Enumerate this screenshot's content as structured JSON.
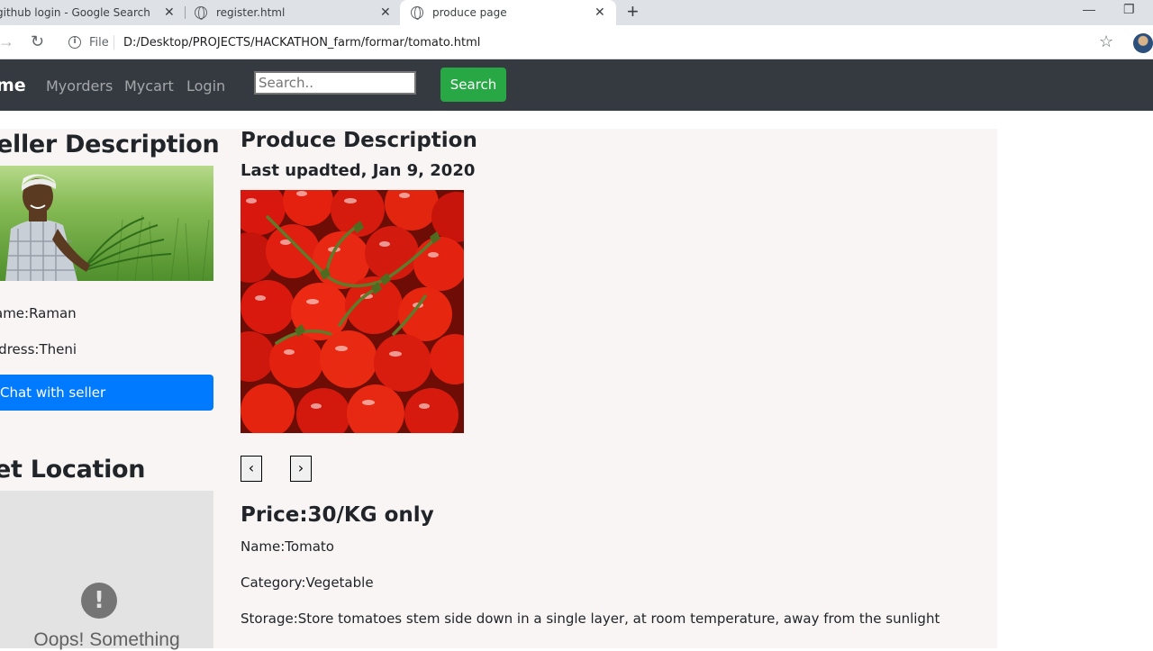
{
  "browser": {
    "tabs": [
      {
        "title": "github login - Google Search",
        "icon": "google-icon",
        "active": false
      },
      {
        "title": "register.html",
        "icon": "globe-icon",
        "active": false
      },
      {
        "title": "produce page",
        "icon": "globe-icon",
        "active": true
      }
    ],
    "tab_close": "✕",
    "new_tab": "+",
    "window_controls": {
      "minimize": "—",
      "restore": "❐"
    },
    "nav": {
      "back": "→",
      "reload": "↻"
    },
    "address": {
      "scheme_label": "File",
      "url": "D:/Desktop/PROJECTS/HACKATHON_farm/formar/tomato.html"
    },
    "bookmark_icon": "☆"
  },
  "navbar": {
    "brand": "me",
    "links": [
      "Myorders",
      "Mycart",
      "Login"
    ],
    "search_placeholder": "Search..",
    "search_button": "Search",
    "bg_color": "#343a40",
    "search_color": "#28a745"
  },
  "seller": {
    "heading": "eller Description",
    "name": "ame:Raman",
    "address": "ldress:Theni",
    "chat_button": "Chat with seller",
    "chat_color": "#007bff"
  },
  "location": {
    "heading": "et Location",
    "error_icon": "!",
    "error_text": "Oops! Something"
  },
  "produce": {
    "heading": "Produce Description",
    "updated": "Last upadted, Jan 9, 2020",
    "prev": "‹",
    "next": "›",
    "price": "Price:30/KG only",
    "name": "Name:Tomato",
    "category": "Category:Vegetable",
    "storage": "Storage:Store tomatoes stem side down in a single layer, at room temperature, away from the sunlight"
  }
}
